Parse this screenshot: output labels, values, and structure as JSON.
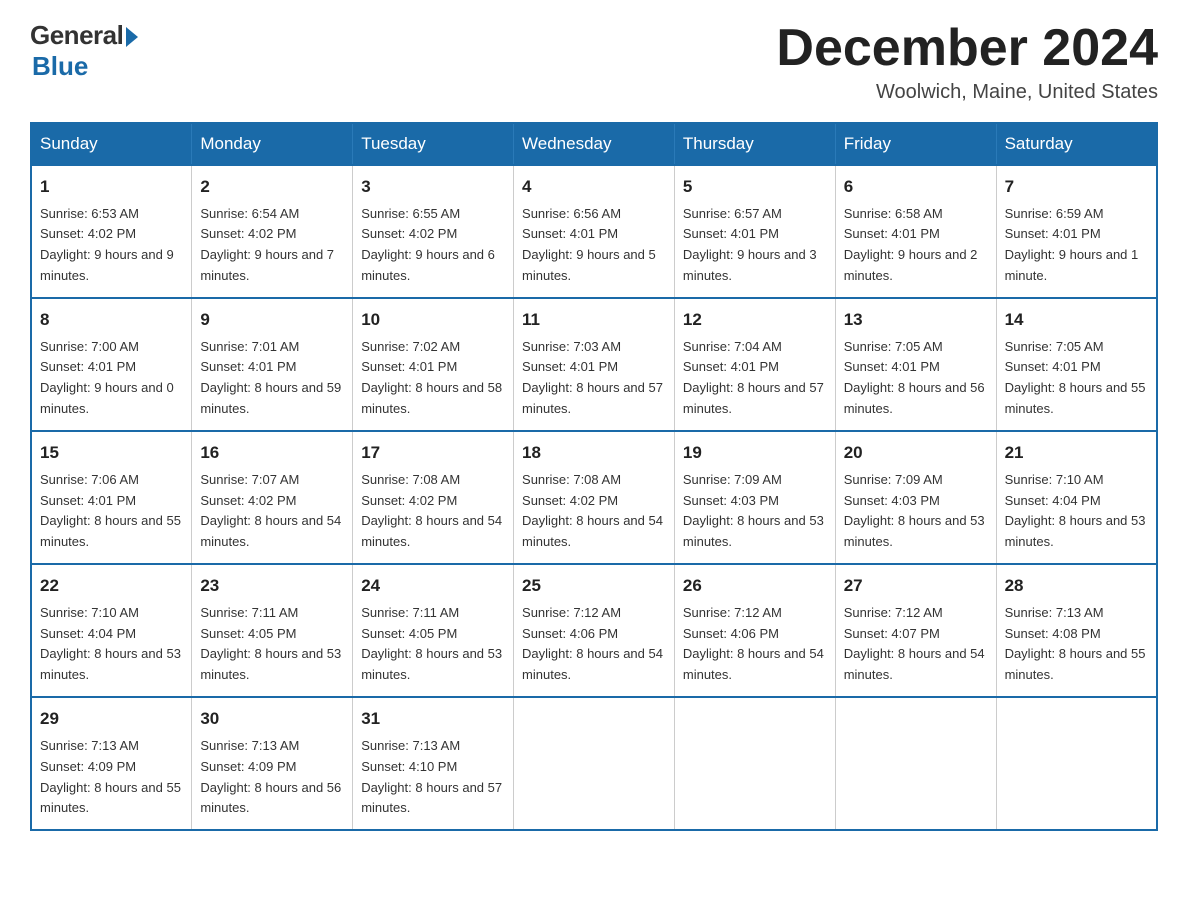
{
  "logo": {
    "general": "General",
    "blue": "Blue",
    "subtitle": "Blue"
  },
  "header": {
    "month": "December 2024",
    "location": "Woolwich, Maine, United States"
  },
  "weekdays": [
    "Sunday",
    "Monday",
    "Tuesday",
    "Wednesday",
    "Thursday",
    "Friday",
    "Saturday"
  ],
  "weeks": [
    [
      {
        "day": "1",
        "sunrise": "6:53 AM",
        "sunset": "4:02 PM",
        "daylight": "9 hours and 9 minutes."
      },
      {
        "day": "2",
        "sunrise": "6:54 AM",
        "sunset": "4:02 PM",
        "daylight": "9 hours and 7 minutes."
      },
      {
        "day": "3",
        "sunrise": "6:55 AM",
        "sunset": "4:02 PM",
        "daylight": "9 hours and 6 minutes."
      },
      {
        "day": "4",
        "sunrise": "6:56 AM",
        "sunset": "4:01 PM",
        "daylight": "9 hours and 5 minutes."
      },
      {
        "day": "5",
        "sunrise": "6:57 AM",
        "sunset": "4:01 PM",
        "daylight": "9 hours and 3 minutes."
      },
      {
        "day": "6",
        "sunrise": "6:58 AM",
        "sunset": "4:01 PM",
        "daylight": "9 hours and 2 minutes."
      },
      {
        "day": "7",
        "sunrise": "6:59 AM",
        "sunset": "4:01 PM",
        "daylight": "9 hours and 1 minute."
      }
    ],
    [
      {
        "day": "8",
        "sunrise": "7:00 AM",
        "sunset": "4:01 PM",
        "daylight": "9 hours and 0 minutes."
      },
      {
        "day": "9",
        "sunrise": "7:01 AM",
        "sunset": "4:01 PM",
        "daylight": "8 hours and 59 minutes."
      },
      {
        "day": "10",
        "sunrise": "7:02 AM",
        "sunset": "4:01 PM",
        "daylight": "8 hours and 58 minutes."
      },
      {
        "day": "11",
        "sunrise": "7:03 AM",
        "sunset": "4:01 PM",
        "daylight": "8 hours and 57 minutes."
      },
      {
        "day": "12",
        "sunrise": "7:04 AM",
        "sunset": "4:01 PM",
        "daylight": "8 hours and 57 minutes."
      },
      {
        "day": "13",
        "sunrise": "7:05 AM",
        "sunset": "4:01 PM",
        "daylight": "8 hours and 56 minutes."
      },
      {
        "day": "14",
        "sunrise": "7:05 AM",
        "sunset": "4:01 PM",
        "daylight": "8 hours and 55 minutes."
      }
    ],
    [
      {
        "day": "15",
        "sunrise": "7:06 AM",
        "sunset": "4:01 PM",
        "daylight": "8 hours and 55 minutes."
      },
      {
        "day": "16",
        "sunrise": "7:07 AM",
        "sunset": "4:02 PM",
        "daylight": "8 hours and 54 minutes."
      },
      {
        "day": "17",
        "sunrise": "7:08 AM",
        "sunset": "4:02 PM",
        "daylight": "8 hours and 54 minutes."
      },
      {
        "day": "18",
        "sunrise": "7:08 AM",
        "sunset": "4:02 PM",
        "daylight": "8 hours and 54 minutes."
      },
      {
        "day": "19",
        "sunrise": "7:09 AM",
        "sunset": "4:03 PM",
        "daylight": "8 hours and 53 minutes."
      },
      {
        "day": "20",
        "sunrise": "7:09 AM",
        "sunset": "4:03 PM",
        "daylight": "8 hours and 53 minutes."
      },
      {
        "day": "21",
        "sunrise": "7:10 AM",
        "sunset": "4:04 PM",
        "daylight": "8 hours and 53 minutes."
      }
    ],
    [
      {
        "day": "22",
        "sunrise": "7:10 AM",
        "sunset": "4:04 PM",
        "daylight": "8 hours and 53 minutes."
      },
      {
        "day": "23",
        "sunrise": "7:11 AM",
        "sunset": "4:05 PM",
        "daylight": "8 hours and 53 minutes."
      },
      {
        "day": "24",
        "sunrise": "7:11 AM",
        "sunset": "4:05 PM",
        "daylight": "8 hours and 53 minutes."
      },
      {
        "day": "25",
        "sunrise": "7:12 AM",
        "sunset": "4:06 PM",
        "daylight": "8 hours and 54 minutes."
      },
      {
        "day": "26",
        "sunrise": "7:12 AM",
        "sunset": "4:06 PM",
        "daylight": "8 hours and 54 minutes."
      },
      {
        "day": "27",
        "sunrise": "7:12 AM",
        "sunset": "4:07 PM",
        "daylight": "8 hours and 54 minutes."
      },
      {
        "day": "28",
        "sunrise": "7:13 AM",
        "sunset": "4:08 PM",
        "daylight": "8 hours and 55 minutes."
      }
    ],
    [
      {
        "day": "29",
        "sunrise": "7:13 AM",
        "sunset": "4:09 PM",
        "daylight": "8 hours and 55 minutes."
      },
      {
        "day": "30",
        "sunrise": "7:13 AM",
        "sunset": "4:09 PM",
        "daylight": "8 hours and 56 minutes."
      },
      {
        "day": "31",
        "sunrise": "7:13 AM",
        "sunset": "4:10 PM",
        "daylight": "8 hours and 57 minutes."
      },
      null,
      null,
      null,
      null
    ]
  ],
  "labels": {
    "sunrise": "Sunrise:",
    "sunset": "Sunset:",
    "daylight": "Daylight:"
  }
}
